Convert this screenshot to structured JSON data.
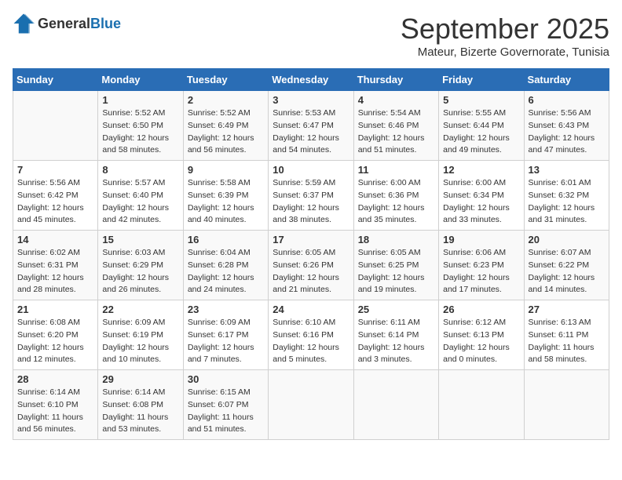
{
  "logo": {
    "general": "General",
    "blue": "Blue"
  },
  "title": "September 2025",
  "subtitle": "Mateur, Bizerte Governorate, Tunisia",
  "weekdays": [
    "Sunday",
    "Monday",
    "Tuesday",
    "Wednesday",
    "Thursday",
    "Friday",
    "Saturday"
  ],
  "weeks": [
    [
      {
        "day": "",
        "sunrise": "",
        "sunset": "",
        "daylight": ""
      },
      {
        "day": "1",
        "sunrise": "Sunrise: 5:52 AM",
        "sunset": "Sunset: 6:50 PM",
        "daylight": "Daylight: 12 hours and 58 minutes."
      },
      {
        "day": "2",
        "sunrise": "Sunrise: 5:52 AM",
        "sunset": "Sunset: 6:49 PM",
        "daylight": "Daylight: 12 hours and 56 minutes."
      },
      {
        "day": "3",
        "sunrise": "Sunrise: 5:53 AM",
        "sunset": "Sunset: 6:47 PM",
        "daylight": "Daylight: 12 hours and 54 minutes."
      },
      {
        "day": "4",
        "sunrise": "Sunrise: 5:54 AM",
        "sunset": "Sunset: 6:46 PM",
        "daylight": "Daylight: 12 hours and 51 minutes."
      },
      {
        "day": "5",
        "sunrise": "Sunrise: 5:55 AM",
        "sunset": "Sunset: 6:44 PM",
        "daylight": "Daylight: 12 hours and 49 minutes."
      },
      {
        "day": "6",
        "sunrise": "Sunrise: 5:56 AM",
        "sunset": "Sunset: 6:43 PM",
        "daylight": "Daylight: 12 hours and 47 minutes."
      }
    ],
    [
      {
        "day": "7",
        "sunrise": "Sunrise: 5:56 AM",
        "sunset": "Sunset: 6:42 PM",
        "daylight": "Daylight: 12 hours and 45 minutes."
      },
      {
        "day": "8",
        "sunrise": "Sunrise: 5:57 AM",
        "sunset": "Sunset: 6:40 PM",
        "daylight": "Daylight: 12 hours and 42 minutes."
      },
      {
        "day": "9",
        "sunrise": "Sunrise: 5:58 AM",
        "sunset": "Sunset: 6:39 PM",
        "daylight": "Daylight: 12 hours and 40 minutes."
      },
      {
        "day": "10",
        "sunrise": "Sunrise: 5:59 AM",
        "sunset": "Sunset: 6:37 PM",
        "daylight": "Daylight: 12 hours and 38 minutes."
      },
      {
        "day": "11",
        "sunrise": "Sunrise: 6:00 AM",
        "sunset": "Sunset: 6:36 PM",
        "daylight": "Daylight: 12 hours and 35 minutes."
      },
      {
        "day": "12",
        "sunrise": "Sunrise: 6:00 AM",
        "sunset": "Sunset: 6:34 PM",
        "daylight": "Daylight: 12 hours and 33 minutes."
      },
      {
        "day": "13",
        "sunrise": "Sunrise: 6:01 AM",
        "sunset": "Sunset: 6:32 PM",
        "daylight": "Daylight: 12 hours and 31 minutes."
      }
    ],
    [
      {
        "day": "14",
        "sunrise": "Sunrise: 6:02 AM",
        "sunset": "Sunset: 6:31 PM",
        "daylight": "Daylight: 12 hours and 28 minutes."
      },
      {
        "day": "15",
        "sunrise": "Sunrise: 6:03 AM",
        "sunset": "Sunset: 6:29 PM",
        "daylight": "Daylight: 12 hours and 26 minutes."
      },
      {
        "day": "16",
        "sunrise": "Sunrise: 6:04 AM",
        "sunset": "Sunset: 6:28 PM",
        "daylight": "Daylight: 12 hours and 24 minutes."
      },
      {
        "day": "17",
        "sunrise": "Sunrise: 6:05 AM",
        "sunset": "Sunset: 6:26 PM",
        "daylight": "Daylight: 12 hours and 21 minutes."
      },
      {
        "day": "18",
        "sunrise": "Sunrise: 6:05 AM",
        "sunset": "Sunset: 6:25 PM",
        "daylight": "Daylight: 12 hours and 19 minutes."
      },
      {
        "day": "19",
        "sunrise": "Sunrise: 6:06 AM",
        "sunset": "Sunset: 6:23 PM",
        "daylight": "Daylight: 12 hours and 17 minutes."
      },
      {
        "day": "20",
        "sunrise": "Sunrise: 6:07 AM",
        "sunset": "Sunset: 6:22 PM",
        "daylight": "Daylight: 12 hours and 14 minutes."
      }
    ],
    [
      {
        "day": "21",
        "sunrise": "Sunrise: 6:08 AM",
        "sunset": "Sunset: 6:20 PM",
        "daylight": "Daylight: 12 hours and 12 minutes."
      },
      {
        "day": "22",
        "sunrise": "Sunrise: 6:09 AM",
        "sunset": "Sunset: 6:19 PM",
        "daylight": "Daylight: 12 hours and 10 minutes."
      },
      {
        "day": "23",
        "sunrise": "Sunrise: 6:09 AM",
        "sunset": "Sunset: 6:17 PM",
        "daylight": "Daylight: 12 hours and 7 minutes."
      },
      {
        "day": "24",
        "sunrise": "Sunrise: 6:10 AM",
        "sunset": "Sunset: 6:16 PM",
        "daylight": "Daylight: 12 hours and 5 minutes."
      },
      {
        "day": "25",
        "sunrise": "Sunrise: 6:11 AM",
        "sunset": "Sunset: 6:14 PM",
        "daylight": "Daylight: 12 hours and 3 minutes."
      },
      {
        "day": "26",
        "sunrise": "Sunrise: 6:12 AM",
        "sunset": "Sunset: 6:13 PM",
        "daylight": "Daylight: 12 hours and 0 minutes."
      },
      {
        "day": "27",
        "sunrise": "Sunrise: 6:13 AM",
        "sunset": "Sunset: 6:11 PM",
        "daylight": "Daylight: 11 hours and 58 minutes."
      }
    ],
    [
      {
        "day": "28",
        "sunrise": "Sunrise: 6:14 AM",
        "sunset": "Sunset: 6:10 PM",
        "daylight": "Daylight: 11 hours and 56 minutes."
      },
      {
        "day": "29",
        "sunrise": "Sunrise: 6:14 AM",
        "sunset": "Sunset: 6:08 PM",
        "daylight": "Daylight: 11 hours and 53 minutes."
      },
      {
        "day": "30",
        "sunrise": "Sunrise: 6:15 AM",
        "sunset": "Sunset: 6:07 PM",
        "daylight": "Daylight: 11 hours and 51 minutes."
      },
      {
        "day": "",
        "sunrise": "",
        "sunset": "",
        "daylight": ""
      },
      {
        "day": "",
        "sunrise": "",
        "sunset": "",
        "daylight": ""
      },
      {
        "day": "",
        "sunrise": "",
        "sunset": "",
        "daylight": ""
      },
      {
        "day": "",
        "sunrise": "",
        "sunset": "",
        "daylight": ""
      }
    ]
  ]
}
